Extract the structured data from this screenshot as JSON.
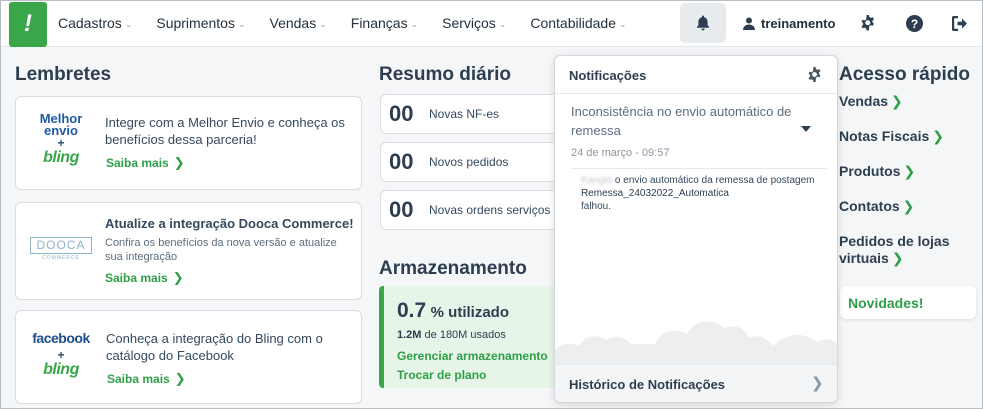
{
  "nav": {
    "items": [
      {
        "label": "Cadastros"
      },
      {
        "label": "Suprimentos"
      },
      {
        "label": "Vendas"
      },
      {
        "label": "Finanças"
      },
      {
        "label": "Serviços"
      },
      {
        "label": "Contabilidade"
      }
    ],
    "user": "treinamento"
  },
  "lembretes": {
    "title": "Lembretes",
    "cards": [
      {
        "brand_line1": "Melhor",
        "brand_line2": "envio",
        "plus": "+",
        "bling": "bling",
        "text": "Integre com a Melhor Envio e conheça os benefícios dessa parceria!",
        "link": "Saiba mais"
      },
      {
        "brand": "DOOCA",
        "brand_sub": "COMMERCE",
        "title": "Atualize a integração Dooca Commerce!",
        "sub": "Confira os benefícios da nova versão e atualize sua integração",
        "link": "Saiba mais"
      },
      {
        "brand": "facebook",
        "plus": "+",
        "bling": "bling",
        "text": "Conheça a integração do Bling com o catálogo do Facebook",
        "link": "Saiba mais"
      }
    ]
  },
  "resumo": {
    "title": "Resumo diário",
    "items": [
      {
        "value": "00",
        "label": "Novas NF-es"
      },
      {
        "value": "00",
        "label": "Novos pedidos"
      },
      {
        "value": "00",
        "label": "Novas ordens serviços"
      }
    ]
  },
  "armazenamento": {
    "title": "Armazenamento",
    "percent": "0.7",
    "percent_label": "% utilizado",
    "used": "1.2M",
    "used_rest": "de 180M usados",
    "manage": "Gerenciar armazenamento",
    "plan": "Trocar de plano"
  },
  "notificacoes": {
    "title": "Notificações",
    "item_title": "Inconsistência no envio automático de remessa",
    "date": "24 de março - 09:57",
    "detail_prefix": "Kanglo",
    "detail_text": " o envio automático da remessa de postagem ",
    "detail_bold": "Remessa_24032022_Automatica",
    "detail_end": "falhou.",
    "footer": "Histórico de Notificações"
  },
  "acesso": {
    "title": "Acesso rápido",
    "items": [
      {
        "label": "Vendas"
      },
      {
        "label": "Notas Fiscais"
      },
      {
        "label": "Produtos"
      },
      {
        "label": "Contatos"
      },
      {
        "label": "Pedidos de lojas virtuais"
      }
    ],
    "novidades": "Novidades!"
  },
  "colors": {
    "accent": "#3aa64a",
    "link": "#2e9e48",
    "text": "#2c3e50"
  }
}
